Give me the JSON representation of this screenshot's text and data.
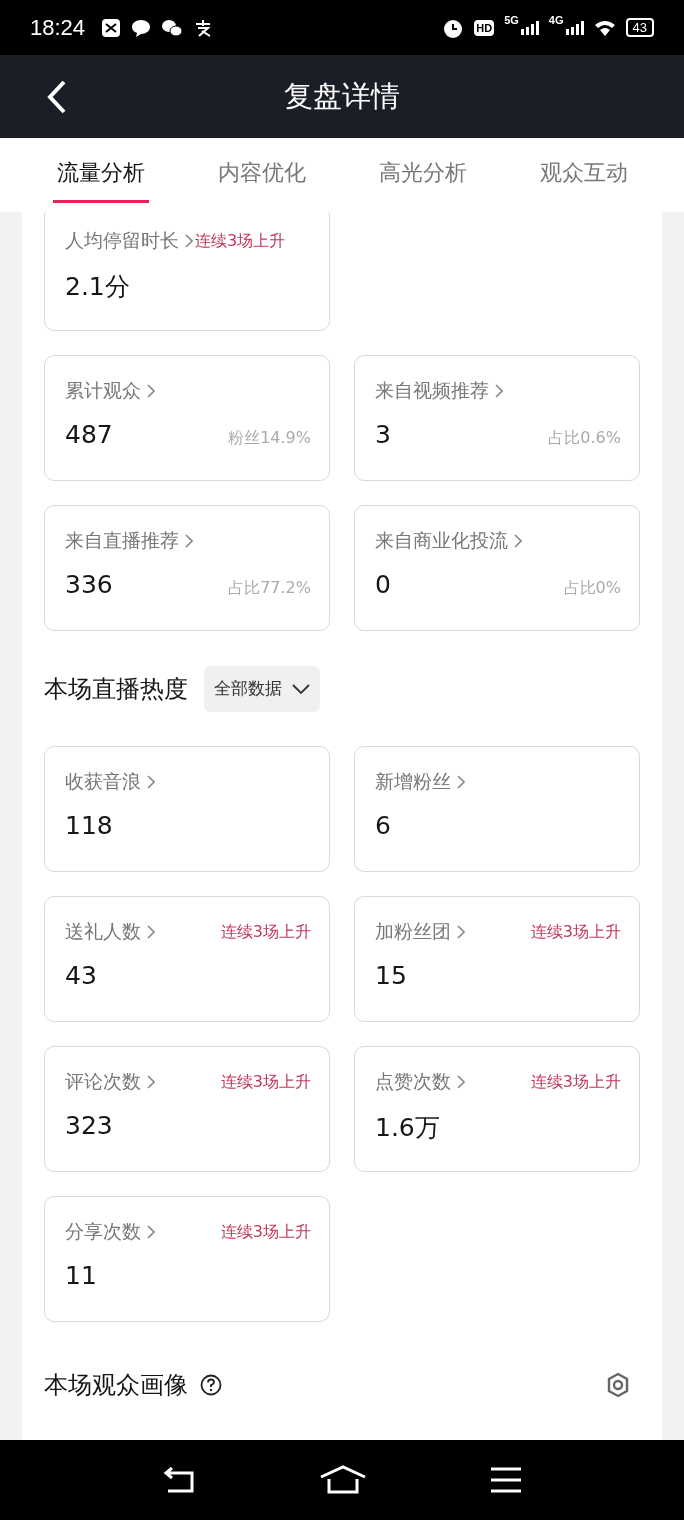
{
  "status_bar": {
    "time": "18:24",
    "hd": "HD",
    "net1": "5G",
    "net2": "4G",
    "battery": "43"
  },
  "header": {
    "title": "复盘详情"
  },
  "tabs": [
    {
      "label": "流量分析",
      "selected": true
    },
    {
      "label": "内容优化",
      "selected": false
    },
    {
      "label": "高光分析",
      "selected": false
    },
    {
      "label": "观众互动",
      "selected": false
    }
  ],
  "traffic_rows": [
    [
      {
        "label": "人均停留时长",
        "value": "2.1分",
        "trend": "连续3场上升"
      }
    ],
    [
      {
        "label": "累计观众",
        "value": "487",
        "note": "粉丝14.9%"
      },
      {
        "label": "来自视频推荐",
        "value": "3",
        "note": "占比0.6%"
      }
    ],
    [
      {
        "label": "来自直播推荐",
        "value": "336",
        "note": "占比77.2%"
      },
      {
        "label": "来自商业化投流",
        "value": "0",
        "note": "占比0%"
      }
    ]
  ],
  "heat_section": {
    "title": "本场直播热度",
    "filter": "全部数据",
    "cards": [
      {
        "label": "收获音浪",
        "value": "118"
      },
      {
        "label": "新增粉丝",
        "value": "6"
      },
      {
        "label": "送礼人数",
        "value": "43",
        "trend": "连续3场上升"
      },
      {
        "label": "加粉丝团",
        "value": "15",
        "trend": "连续3场上升"
      },
      {
        "label": "评论次数",
        "value": "323",
        "trend": "连续3场上升"
      },
      {
        "label": "点赞次数",
        "value": "1.6万",
        "trend": "连续3场上升"
      },
      {
        "label": "分享次数",
        "value": "11",
        "trend": "连续3场上升"
      }
    ]
  },
  "portrait_section": {
    "title": "本场观众画像"
  }
}
